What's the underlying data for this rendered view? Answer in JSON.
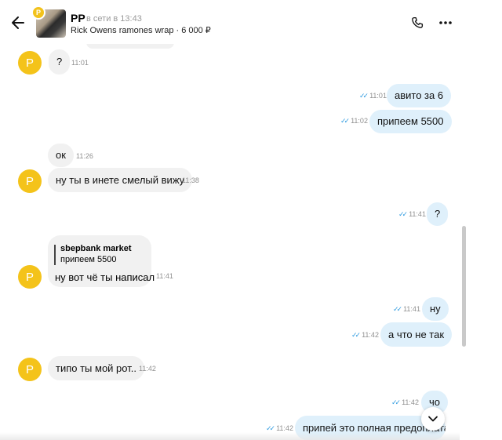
{
  "header": {
    "avatar_letter": "Р",
    "name": "РР",
    "status": "в сети в 13:43",
    "item": "Rick Owens ramones wrap · 6 000 ₽",
    "icons": {
      "back": "arrow-left-icon",
      "call": "phone-icon",
      "menu": "more-dots-icon"
    }
  },
  "colors": {
    "avatar": "#f4c31a",
    "outgoing_bubble": "#dff0fb",
    "incoming_bubble": "#f1f1f1",
    "check_mark": "#2f9be0"
  },
  "messages": [
    {
      "dir": "in",
      "text": "?",
      "time": "11:01"
    },
    {
      "dir": "out",
      "text": "авито за 6",
      "time": "11:01"
    },
    {
      "dir": "out",
      "text": "припеем 5500",
      "time": "11:02"
    },
    {
      "dir": "in",
      "text": "ок",
      "time": "11:26"
    },
    {
      "dir": "in",
      "text": "ну ты в инете смелый вижу",
      "time": "11:38"
    },
    {
      "dir": "out",
      "text": "?",
      "time": "11:41"
    },
    {
      "dir": "in",
      "reply_author": "sbepbank market",
      "reply_text": "припеем 5500",
      "text": "ну вот чё ты написал",
      "time": "11:41"
    },
    {
      "dir": "out",
      "text": "ну",
      "time": "11:41"
    },
    {
      "dir": "out",
      "text": "а что не так",
      "time": "11:42"
    },
    {
      "dir": "in",
      "text": "типо ты мой рот..",
      "time": "11:42"
    },
    {
      "dir": "out",
      "text": "чо",
      "time": "11:42"
    },
    {
      "dir": "out",
      "text": "припей это полная предоплата",
      "time": "11:42"
    }
  ],
  "scroll_button_icon": "chevron-down-icon"
}
